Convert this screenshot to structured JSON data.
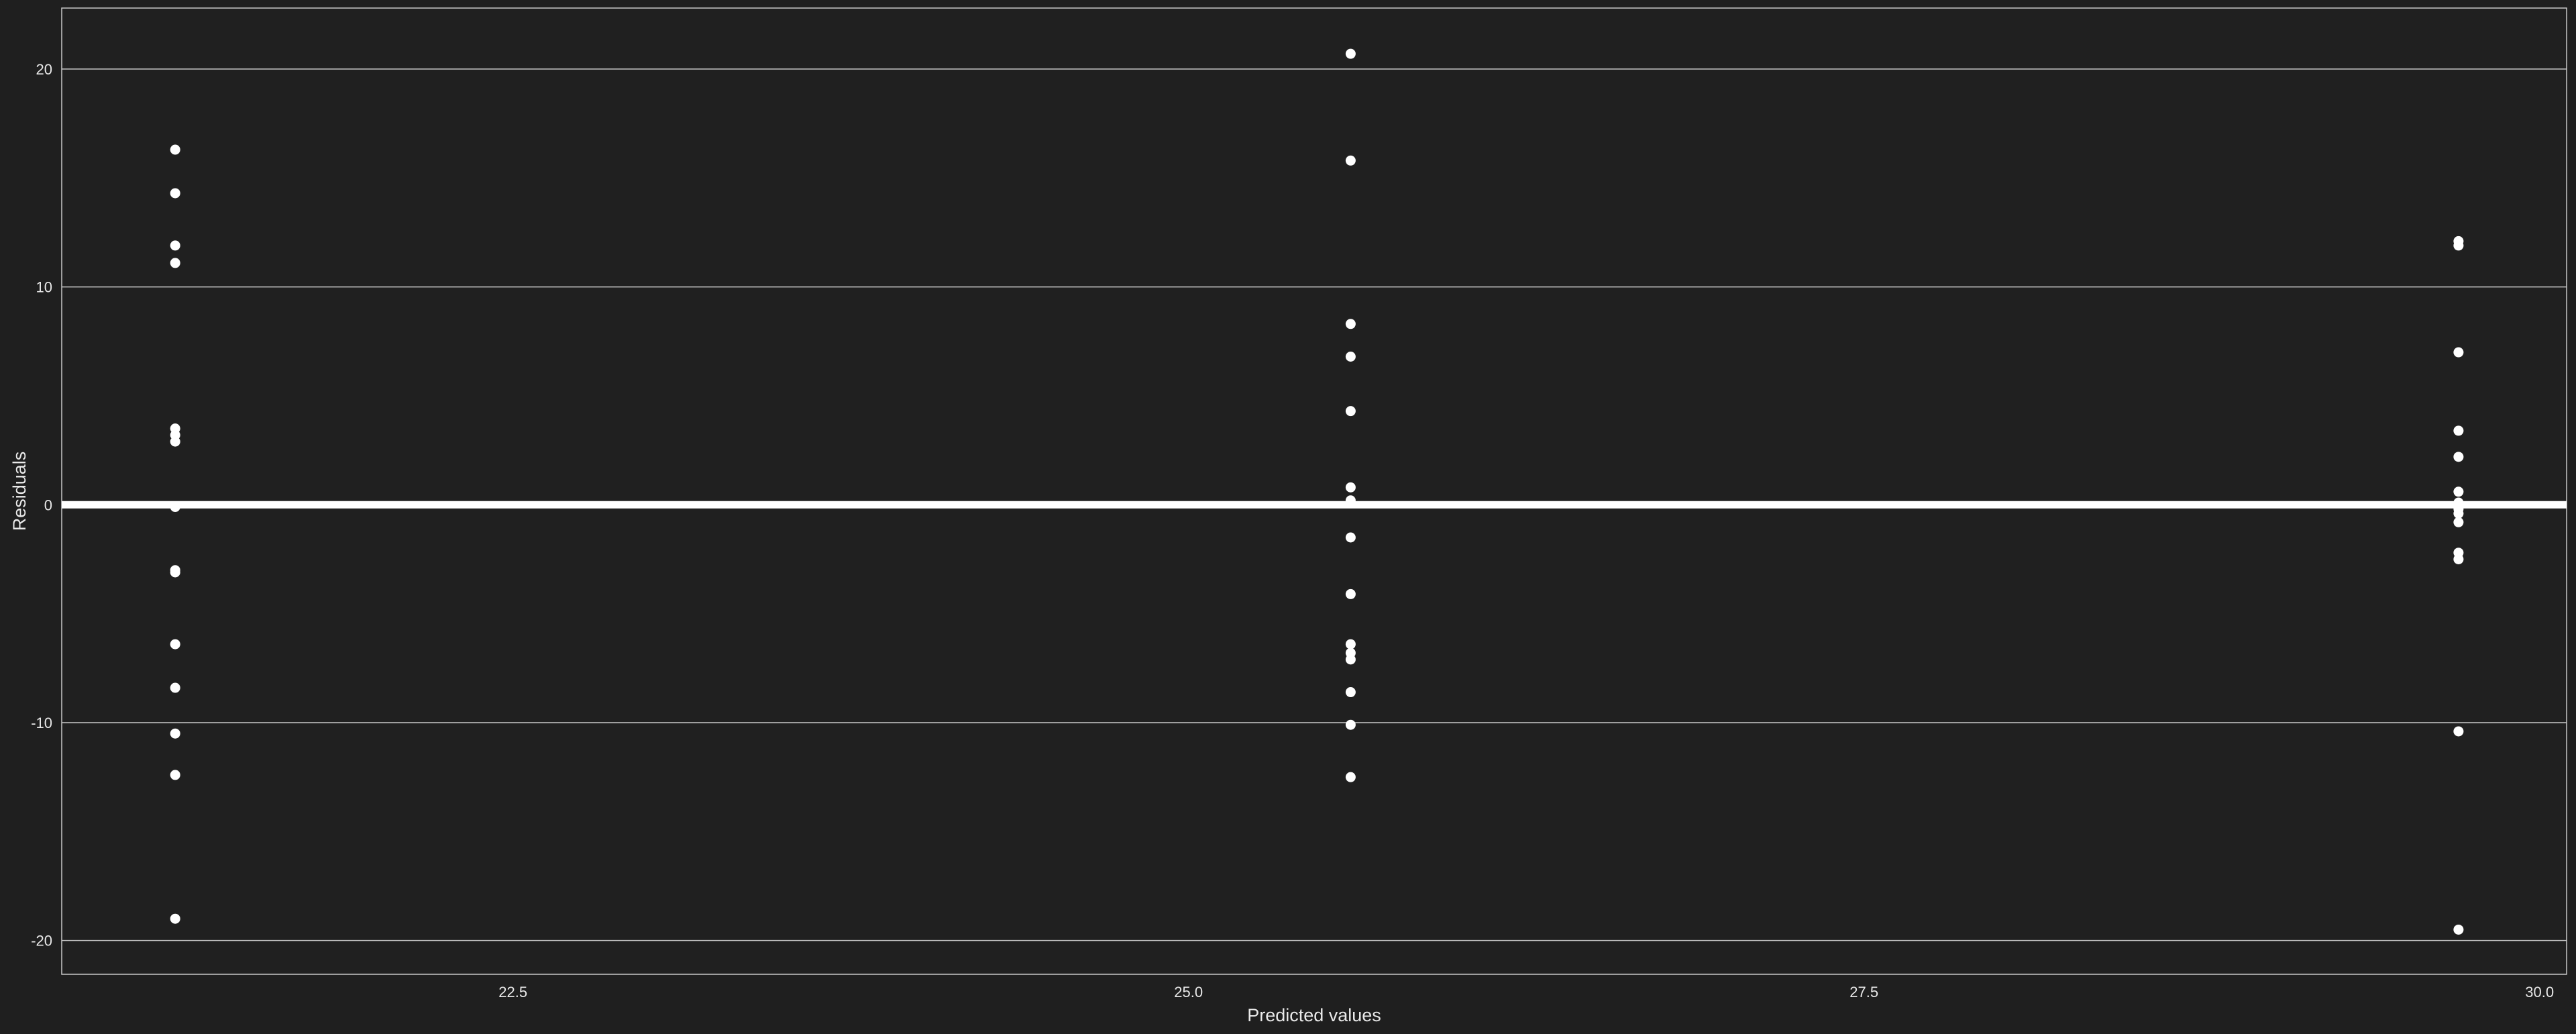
{
  "colors": {
    "background": "#1f1f1f",
    "panel": "#202020",
    "grid": "#c9c9c9",
    "points": "#ffffff",
    "text": "#e9e9e9",
    "zero_line": "#ffffff"
  },
  "chart_data": {
    "type": "scatter",
    "title": "",
    "xlabel": "Predicted values",
    "ylabel": "Residuals",
    "xlim": [
      20.83,
      30.1
    ],
    "ylim": [
      -21.55,
      22.8
    ],
    "x_ticks": [
      {
        "value": 22.5,
        "label": "22.5"
      },
      {
        "value": 25.0,
        "label": "25.0"
      },
      {
        "value": 27.5,
        "label": "27.5"
      },
      {
        "value": 30.0,
        "label": "30.0"
      }
    ],
    "y_ticks": [
      {
        "value": -20,
        "label": "-20"
      },
      {
        "value": -10,
        "label": "-10"
      },
      {
        "value": 0,
        "label": "0"
      },
      {
        "value": 10,
        "label": "10"
      },
      {
        "value": 20,
        "label": "20"
      }
    ],
    "grid": "horizontal",
    "reference_line": 0,
    "points": [
      {
        "x": 21.25,
        "y": 16.3
      },
      {
        "x": 21.25,
        "y": 14.3
      },
      {
        "x": 21.25,
        "y": 11.9
      },
      {
        "x": 21.25,
        "y": 11.1
      },
      {
        "x": 21.25,
        "y": 3.5
      },
      {
        "x": 21.25,
        "y": 3.2
      },
      {
        "x": 21.25,
        "y": 2.9
      },
      {
        "x": 21.25,
        "y": -0.1
      },
      {
        "x": 21.25,
        "y": -3.0
      },
      {
        "x": 21.25,
        "y": -3.1
      },
      {
        "x": 21.25,
        "y": -6.4
      },
      {
        "x": 21.25,
        "y": -8.4
      },
      {
        "x": 21.25,
        "y": -10.5
      },
      {
        "x": 21.25,
        "y": -12.4
      },
      {
        "x": 21.25,
        "y": -19.0
      },
      {
        "x": 25.6,
        "y": 20.7
      },
      {
        "x": 25.6,
        "y": 15.8
      },
      {
        "x": 25.6,
        "y": 8.3
      },
      {
        "x": 25.6,
        "y": 6.8
      },
      {
        "x": 25.6,
        "y": 4.3
      },
      {
        "x": 25.6,
        "y": 0.8
      },
      {
        "x": 25.6,
        "y": 0.2
      },
      {
        "x": 25.6,
        "y": -1.5
      },
      {
        "x": 25.6,
        "y": -4.1
      },
      {
        "x": 25.6,
        "y": -6.4
      },
      {
        "x": 25.6,
        "y": -6.8
      },
      {
        "x": 25.6,
        "y": -7.1
      },
      {
        "x": 25.6,
        "y": -8.6
      },
      {
        "x": 25.6,
        "y": -10.1
      },
      {
        "x": 25.6,
        "y": -12.5
      },
      {
        "x": 29.7,
        "y": 12.1
      },
      {
        "x": 29.7,
        "y": 11.9
      },
      {
        "x": 29.7,
        "y": 7.0
      },
      {
        "x": 29.7,
        "y": 3.4
      },
      {
        "x": 29.7,
        "y": 2.2
      },
      {
        "x": 29.7,
        "y": 0.6
      },
      {
        "x": 29.7,
        "y": 0.1
      },
      {
        "x": 29.7,
        "y": -0.2
      },
      {
        "x": 29.7,
        "y": -0.4
      },
      {
        "x": 29.7,
        "y": -0.8
      },
      {
        "x": 29.7,
        "y": -2.2
      },
      {
        "x": 29.7,
        "y": -2.5
      },
      {
        "x": 29.7,
        "y": -10.4
      },
      {
        "x": 29.7,
        "y": -19.5
      }
    ]
  }
}
